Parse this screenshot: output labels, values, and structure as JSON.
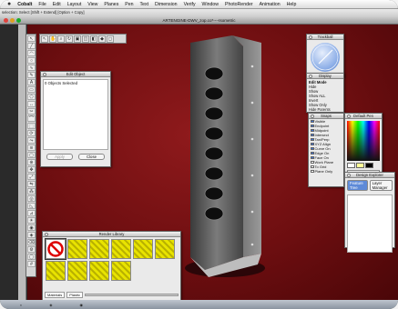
{
  "menubar": {
    "app_name": "Cobalt",
    "items": [
      "File",
      "Edit",
      "Layout",
      "View",
      "Planes",
      "Pen",
      "Text",
      "Dimension",
      "Verify",
      "Window",
      "PhotoRender",
      "Animation",
      "Help"
    ]
  },
  "status": {
    "text": "selection: Select [Shift + Extend] [Option + Copy]"
  },
  "window": {
    "title": "ARTENGINE-DWV_zop.co*----Isometric"
  },
  "edit_object": {
    "title": "Edit Object",
    "info": "0 Objects Selected",
    "apply_label": "Apply",
    "close_label": "Close"
  },
  "render_library": {
    "title": "Render Library",
    "materials_label": "Materials",
    "plastic_label": "Plastic"
  },
  "trackball": {
    "title": "Trackball"
  },
  "display": {
    "title": "Display",
    "subtitle": "Edit Mode",
    "items": [
      "Hide",
      "Show",
      "Show ALL",
      "Invert",
      "Show Only",
      "Hide Parents",
      "Show Parents"
    ]
  },
  "snaps": {
    "title": "Snaps",
    "items": [
      {
        "label": "Visible",
        "on": true
      },
      {
        "label": "Endpoint",
        "on": true
      },
      {
        "label": "Midpoint",
        "on": true
      },
      {
        "label": "Intersect",
        "on": true
      },
      {
        "label": "Tan/Perp",
        "on": true
      },
      {
        "label": "XYZ Align",
        "on": true
      },
      {
        "label": "Curve On",
        "on": true
      },
      {
        "label": "Edge On",
        "on": true
      },
      {
        "label": "Face On",
        "on": true
      },
      {
        "label": "Work Plane",
        "on": false
      },
      {
        "label": "To Grid",
        "on": false
      },
      {
        "label": "Plane Only",
        "on": false
      }
    ]
  },
  "default_pen": {
    "title": "Default Pen",
    "pen_name": "FFFF99",
    "swatch_colors": [
      "#ffffff",
      "#ffff99",
      "#000000"
    ]
  },
  "design_explorer": {
    "title": "Design Explorer",
    "tabs": [
      "Feature Tree",
      "Layer Manager"
    ]
  },
  "colors": {
    "canvas_bg": "#7d1214",
    "selection_blue": "#3a6fd8",
    "render_yellow": "#e8e300"
  }
}
